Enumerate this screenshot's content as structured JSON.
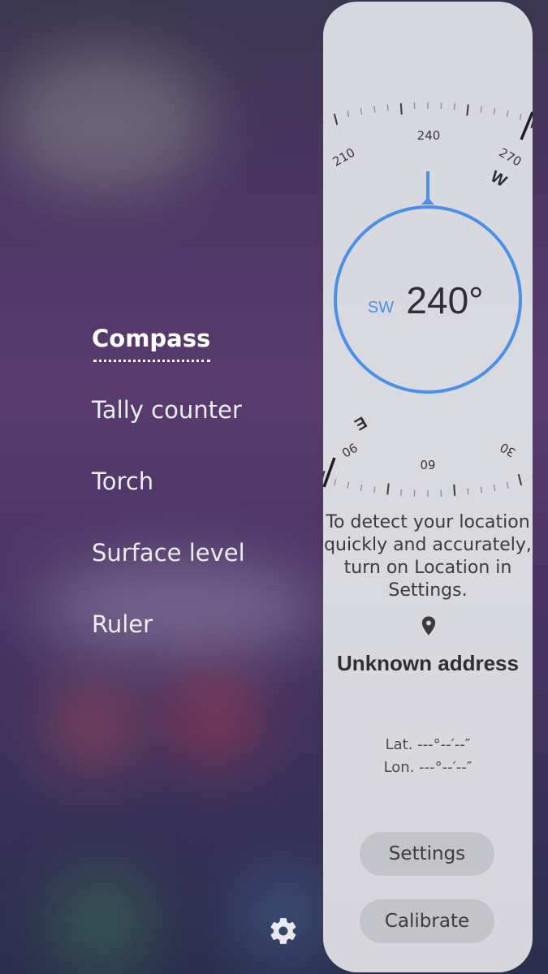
{
  "menu": {
    "items": [
      {
        "label": "Compass",
        "active": true
      },
      {
        "label": "Tally counter",
        "active": false
      },
      {
        "label": "Torch",
        "active": false
      },
      {
        "label": "Surface level",
        "active": false
      },
      {
        "label": "Ruler",
        "active": false
      }
    ],
    "settings_icon": "gear-icon"
  },
  "compass": {
    "heading_direction": "SW",
    "heading_value": "240°",
    "top_ticks": [
      "210",
      "240",
      "270"
    ],
    "top_cardinal": "W",
    "bottom_ticks": [
      "90",
      "60",
      "30"
    ],
    "bottom_cardinal": "E",
    "accent_color": "#4a90e8"
  },
  "location": {
    "message": "To detect your location quickly and accurately, turn on Location in Settings.",
    "pin_icon": "location-pin-icon",
    "address": "Unknown address",
    "lat": "Lat. ---°--′--″",
    "lon": "Lon. ---°--′--″"
  },
  "buttons": {
    "settings": "Settings",
    "calibrate": "Calibrate"
  }
}
